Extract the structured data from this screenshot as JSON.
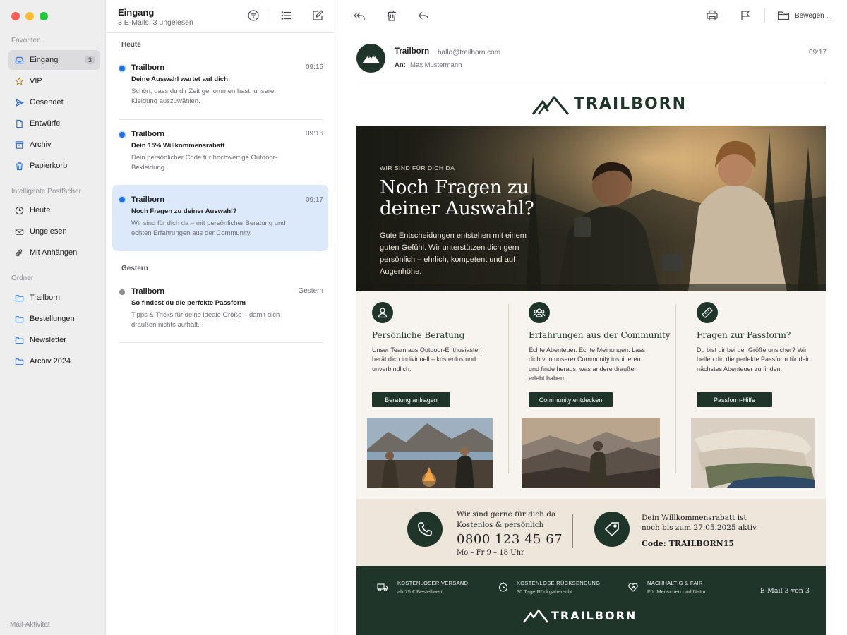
{
  "sidebar": {
    "sections": {
      "favorites": "Favoriten",
      "smart": "Intelligente Postfächer",
      "folders": "Ordner"
    },
    "favorites": [
      {
        "label": "Eingang",
        "icon": "inbox-icon",
        "badge": "3"
      },
      {
        "label": "VIP",
        "icon": "star-icon"
      },
      {
        "label": "Gesendet",
        "icon": "send-icon"
      },
      {
        "label": "Entwürfe",
        "icon": "draft-icon"
      },
      {
        "label": "Archiv",
        "icon": "archive-icon"
      },
      {
        "label": "Papierkorb",
        "icon": "trash-icon"
      }
    ],
    "smart": [
      {
        "label": "Heute",
        "icon": "clock-icon"
      },
      {
        "label": "Ungelesen",
        "icon": "unread-icon"
      },
      {
        "label": "Mit Anhängen",
        "icon": "paperclip-icon"
      }
    ],
    "folders": [
      {
        "label": "Trailborn",
        "icon": "folder-icon"
      },
      {
        "label": "Bestellungen",
        "icon": "folder-icon"
      },
      {
        "label": "Newsletter",
        "icon": "folder-icon"
      },
      {
        "label": "Archiv 2024",
        "icon": "folder-icon"
      }
    ],
    "footer": "Mail-Aktivität"
  },
  "list": {
    "title": "Eingang",
    "subtitle": "3 E-Mails, 3 ungelesen",
    "groups": {
      "today": "Heute",
      "yesterday": "Gestern"
    },
    "mails": [
      {
        "sender": "Trailborn",
        "time": "09:15",
        "subject": "Deine Auswahl wartet auf dich",
        "preview": "Schön, dass du dir Zeit genommen hast, unsere Kleidung auszuwählen.",
        "unread": true
      },
      {
        "sender": "Trailborn",
        "time": "09:16",
        "subject": "Dein 15% Willkommensrabatt",
        "preview": "Dein persönlicher Code für hochwertige Outdoor-Bekleidung.",
        "unread": true
      },
      {
        "sender": "Trailborn",
        "time": "09:17",
        "subject": "Noch Fragen zu deiner Auswahl?",
        "preview": "Wir sind für dich da – mit persönlicher Beratung und echten Erfahrungen aus der Community.",
        "unread": true,
        "selected": true
      },
      {
        "sender": "Trailborn",
        "time": "Gestern",
        "subject": "So findest du die perfekte Passform",
        "preview": "Tipps & Tricks für deine ideale Größe – damit dich draußen nichts aufhält.",
        "unread": false
      }
    ]
  },
  "toolbar": {
    "move_label": "Bewegen ..."
  },
  "message": {
    "from": "Trailborn",
    "address": "hallo@trailborn.com",
    "to_label": "An:",
    "to": "Max Mustermann",
    "time": "09:17"
  },
  "newsletter": {
    "brand": "TRAILBORN",
    "hero": {
      "kicker": "WIR SIND FÜR DICH DA",
      "headline": "Noch Fragen zu deiner Auswahl?",
      "text": "Gute Entscheidungen entstehen mit einem guten Gefühl. Wir unterstützen dich gern persönlich – ehrlich, kompetent und auf Augenhöhe."
    },
    "columns": [
      {
        "title": "Persönliche Beratung",
        "text": "Unser Team aus Outdoor-Enthusiasten berät dich individuell – kostenlos und unverbindlich.",
        "button": "Beratung anfragen",
        "icon": "person-icon"
      },
      {
        "title": "Erfahrungen aus der Community",
        "text": "Echte Abenteuer. Echte Meinungen. Lass dich von unserer Community inspirieren und finde heraus, was andere draußen erlebt haben.",
        "button": "Community entdecken",
        "icon": "community-icon"
      },
      {
        "title": "Fragen zur Passform?",
        "text": "Du bist dir bei der Größe unsicher? Wir helfen dir, die perfekte Passform für dein nächstes Abenteuer zu finden.",
        "button": "Passform-Hilfe",
        "icon": "ruler-icon"
      }
    ],
    "contact": {
      "line1": "Wir sind gerne für dich da",
      "line2": "Kostenlos & persönlich",
      "phone": "0800 123 45 67",
      "hours": "Mo – Fr 9 – 18 Uhr",
      "discount1": "Dein Willkommensrabatt ist",
      "discount2": "noch bis zum 27.05.2025 aktiv.",
      "code": "Code: TRAILBORN15"
    },
    "footer": {
      "items": [
        {
          "title": "KOSTENLOSER VERSAND",
          "sub": "ab 75 € Bestellwert",
          "icon": "truck-icon"
        },
        {
          "title": "KOSTENLOSE RÜCKSENDUNG",
          "sub": "30 Tage Rückgaberecht",
          "icon": "return-icon"
        },
        {
          "title": "NACHHALTIG & FAIR",
          "sub": "Für Menschen und Natur",
          "icon": "heart-leaf-icon"
        }
      ],
      "count": "E-Mail 3 von 3"
    }
  },
  "colors": {
    "accent": "#1f6fe0",
    "brand_green": "#1f3529",
    "selection": "#dbe9fb"
  }
}
